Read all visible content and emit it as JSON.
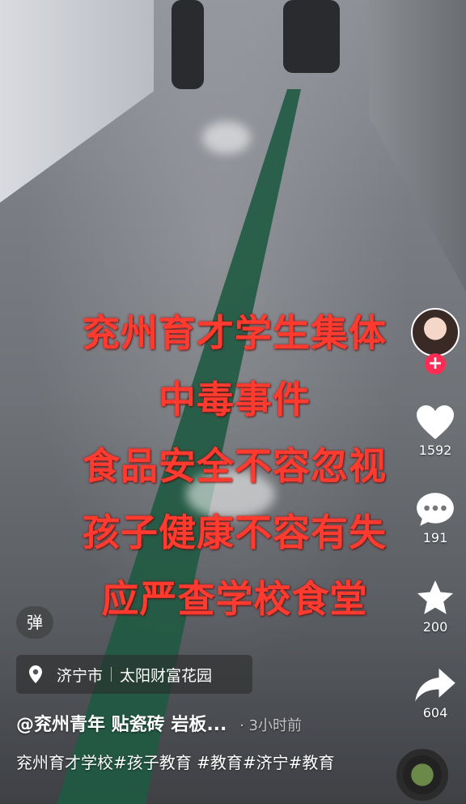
{
  "overlay": {
    "lines": [
      "兖州育才学生集体",
      "中毒事件",
      "食品安全不容忽视",
      "孩子健康不容有失",
      "应严查学校食堂"
    ]
  },
  "actions": {
    "like_count": "1592",
    "comment_count": "191",
    "favorite_count": "200",
    "share_count": "604"
  },
  "danmu_label": "弹",
  "location": {
    "city": "济宁市",
    "place": "太阳财富花园"
  },
  "caption": {
    "author": "@兖州青年 贴瓷砖 岩板...",
    "time": "· 3小时前",
    "tags": "兖州育才学校#孩子教育 #教育#济宁#教育"
  },
  "colors": {
    "overlay_text": "#ff3b30",
    "follow_button": "#fe2c55"
  },
  "icons": [
    "plus-icon",
    "heart-icon",
    "comment-icon",
    "star-icon",
    "share-icon",
    "location-pin-icon",
    "music-disc-icon"
  ]
}
